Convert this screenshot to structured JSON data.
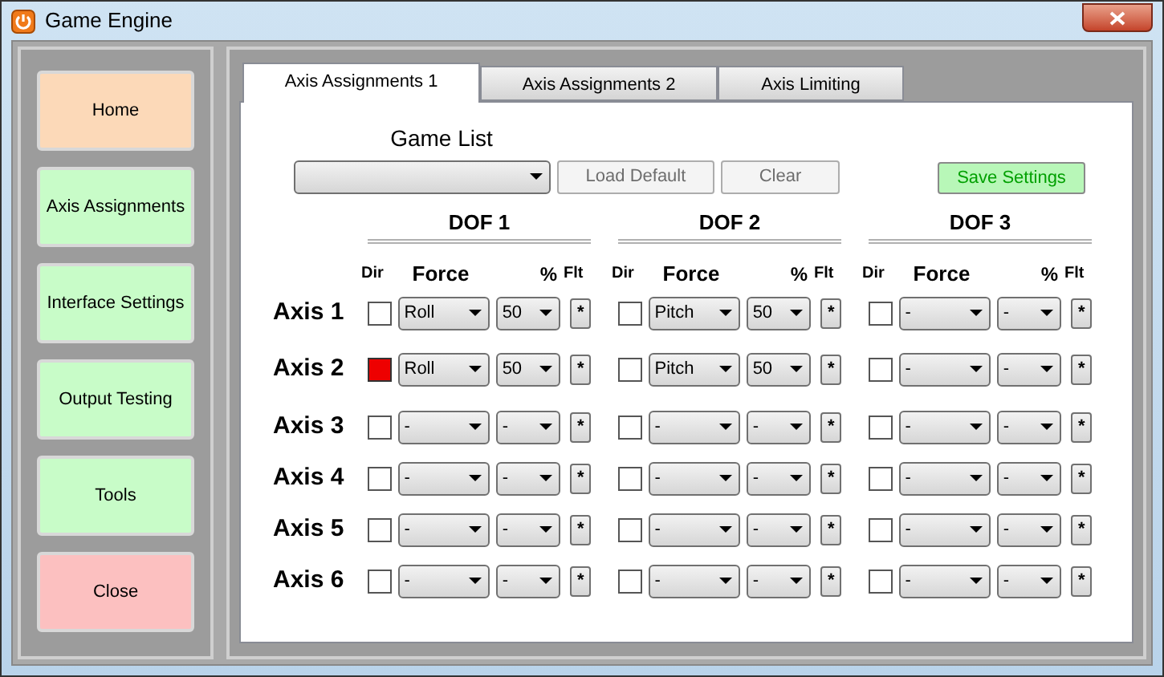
{
  "window": {
    "title": "Game Engine"
  },
  "sidebar": {
    "items": [
      {
        "label": "Home",
        "color": "#fcd9b8"
      },
      {
        "label": "Axis Assignments",
        "color": "#c8fcc8"
      },
      {
        "label": "Interface Settings",
        "color": "#c8fcc8"
      },
      {
        "label": "Output Testing",
        "color": "#c8fcc8"
      },
      {
        "label": "Tools",
        "color": "#c8fcc8"
      },
      {
        "label": "Close",
        "color": "#fcc0c0"
      }
    ]
  },
  "tabs": [
    {
      "label": "Axis Assignments 1",
      "selected": true
    },
    {
      "label": "Axis Assignments 2",
      "selected": false
    },
    {
      "label": "Axis Limiting",
      "selected": false
    }
  ],
  "game_list": {
    "label": "Game List"
  },
  "buttons": [
    {
      "label": "Load Default",
      "kind": "plain"
    },
    {
      "label": "Clear",
      "kind": "plain"
    },
    {
      "label": "Save Settings",
      "kind": "save"
    }
  ],
  "dofs": [
    {
      "title": "DOF 1",
      "columns": [
        "Dir",
        "Force",
        "%",
        "Flt"
      ]
    },
    {
      "title": "DOF 2",
      "columns": [
        "Dir",
        "Force",
        "%",
        "Flt"
      ]
    },
    {
      "title": "DOF 3",
      "columns": [
        "Dir",
        "Force",
        "%",
        "Flt"
      ]
    }
  ],
  "rows": [
    {
      "label": "Axis 1",
      "cells": [
        {
          "dir_checked": false,
          "force": "Roll",
          "percent": "50",
          "flt": "*"
        },
        {
          "dir_checked": false,
          "force": "Pitch",
          "percent": "50",
          "flt": "*"
        },
        {
          "dir_checked": false,
          "force": "-",
          "percent": "-",
          "flt": "*"
        }
      ]
    },
    {
      "label": "Axis 2",
      "cells": [
        {
          "dir_checked": true,
          "force": "Roll",
          "percent": "50",
          "flt": "*"
        },
        {
          "dir_checked": false,
          "force": "Pitch",
          "percent": "50",
          "flt": "*"
        },
        {
          "dir_checked": false,
          "force": "-",
          "percent": "-",
          "flt": "*"
        }
      ]
    },
    {
      "label": "Axis 3",
      "cells": [
        {
          "dir_checked": false,
          "force": "-",
          "percent": "-",
          "flt": "*"
        },
        {
          "dir_checked": false,
          "force": "-",
          "percent": "-",
          "flt": "*"
        },
        {
          "dir_checked": false,
          "force": "-",
          "percent": "-",
          "flt": "*"
        }
      ]
    },
    {
      "label": "Axis 4",
      "cells": [
        {
          "dir_checked": false,
          "force": "-",
          "percent": "-",
          "flt": "*"
        },
        {
          "dir_checked": false,
          "force": "-",
          "percent": "-",
          "flt": "*"
        },
        {
          "dir_checked": false,
          "force": "-",
          "percent": "-",
          "flt": "*"
        }
      ]
    },
    {
      "label": "Axis 5",
      "cells": [
        {
          "dir_checked": false,
          "force": "-",
          "percent": "-",
          "flt": "*"
        },
        {
          "dir_checked": false,
          "force": "-",
          "percent": "-",
          "flt": "*"
        },
        {
          "dir_checked": false,
          "force": "-",
          "percent": "-",
          "flt": "*"
        }
      ]
    },
    {
      "label": "Axis 6",
      "cells": [
        {
          "dir_checked": false,
          "force": "-",
          "percent": "-",
          "flt": "*"
        },
        {
          "dir_checked": false,
          "force": "-",
          "percent": "-",
          "flt": "*"
        },
        {
          "dir_checked": false,
          "force": "-",
          "percent": "-",
          "flt": "*"
        }
      ]
    }
  ]
}
